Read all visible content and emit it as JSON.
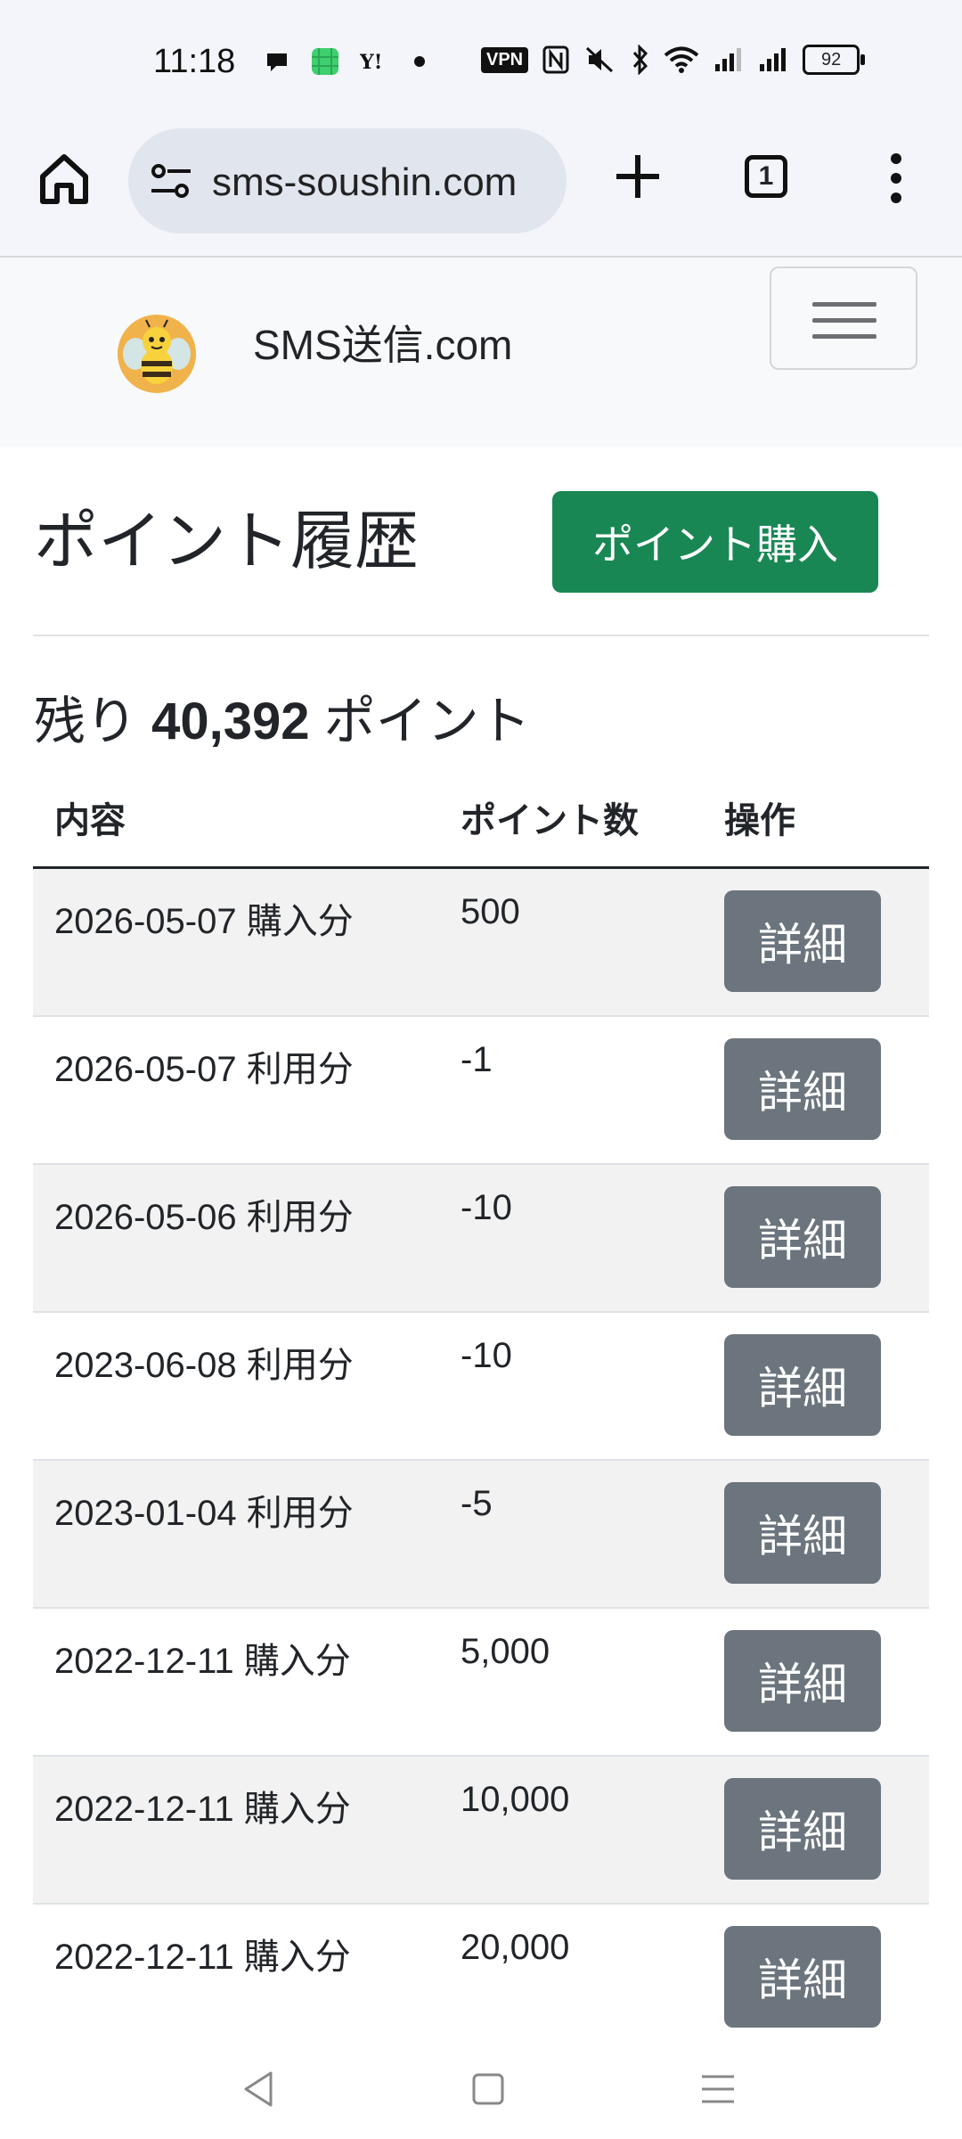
{
  "status_bar": {
    "time": "11:18",
    "vpn_label": "VPN",
    "battery": "92",
    "icons_left": [
      "chat-bubble-icon",
      "green-app-icon",
      "yahoo-icon",
      "dot-icon"
    ],
    "icons_right": [
      "vpn-icon",
      "nfc-icon",
      "mute-icon",
      "bluetooth-icon",
      "wifi-icon",
      "signal-icon",
      "signal-icon",
      "battery-icon"
    ]
  },
  "browser": {
    "url": "sms-soushin.com",
    "tab_count": "1"
  },
  "site": {
    "brand": "SMS送信.com"
  },
  "page": {
    "title": "ポイント履歴",
    "buy_button": "ポイント購入",
    "balance_prefix": "残り",
    "balance_value": "40,392",
    "balance_suffix": "ポイント"
  },
  "table": {
    "headers": [
      "内容",
      "ポイント数",
      "操作"
    ],
    "detail_label": "詳細",
    "rows": [
      {
        "content": "2026-05-07 購入分",
        "points": "500"
      },
      {
        "content": "2026-05-07 利用分",
        "points": "-1"
      },
      {
        "content": "2026-05-06 利用分",
        "points": "-10"
      },
      {
        "content": "2023-06-08 利用分",
        "points": "-10"
      },
      {
        "content": "2023-01-04 利用分",
        "points": "-5"
      },
      {
        "content": "2022-12-11 購入分",
        "points": "5,000"
      },
      {
        "content": "2022-12-11 購入分",
        "points": "10,000"
      },
      {
        "content": "2022-12-11 購入分",
        "points": "20,000"
      }
    ]
  },
  "colors": {
    "buy_button": "#198754",
    "detail_button": "#6c757d",
    "navbar_bg": "#f8f9fa",
    "browser_bg": "#f3f5fa"
  }
}
